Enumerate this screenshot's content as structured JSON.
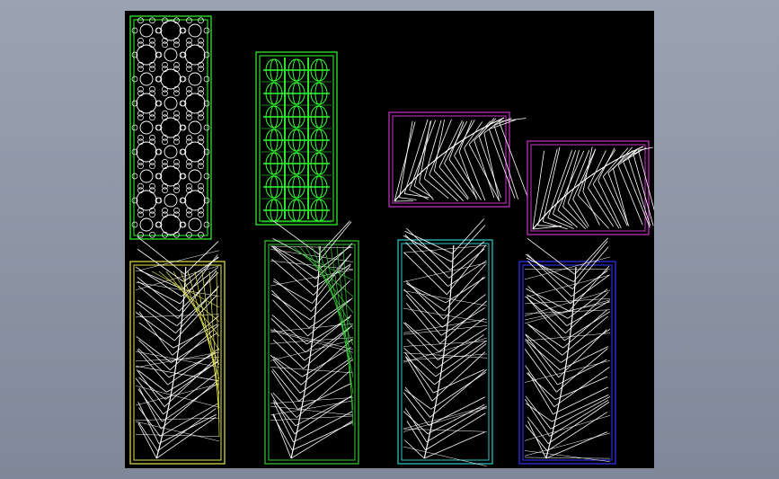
{
  "window": {
    "title": ""
  },
  "viewport": {
    "background_color": "#000000",
    "frame_background_color": "#8f98a8"
  },
  "panels": [
    {
      "id": "panel-1",
      "pattern": "circles-lattice",
      "stroke": "#ffffff",
      "border": "#33ff33"
    },
    {
      "id": "panel-2",
      "pattern": "green-ornament",
      "stroke": "#33ff33",
      "border": "#33ff33"
    },
    {
      "id": "panel-3",
      "pattern": "leaf-horizontal",
      "stroke": "#ffffff",
      "border": "#cc33cc"
    },
    {
      "id": "panel-4",
      "pattern": "leaf-horizontal",
      "stroke": "#ffffff",
      "border": "#cc33cc"
    },
    {
      "id": "panel-5",
      "pattern": "leaf-vertical",
      "stroke": "#ffffff",
      "border": "#e6e64d"
    },
    {
      "id": "panel-6",
      "pattern": "leaf-vertical",
      "stroke": "#ffffff",
      "border": "#33cc33"
    },
    {
      "id": "panel-7",
      "pattern": "leaf-vertical",
      "stroke": "#ffffff",
      "border": "#33cccc"
    },
    {
      "id": "panel-8",
      "pattern": "leaf-vertical",
      "stroke": "#ffffff",
      "border": "#3333ff"
    }
  ]
}
